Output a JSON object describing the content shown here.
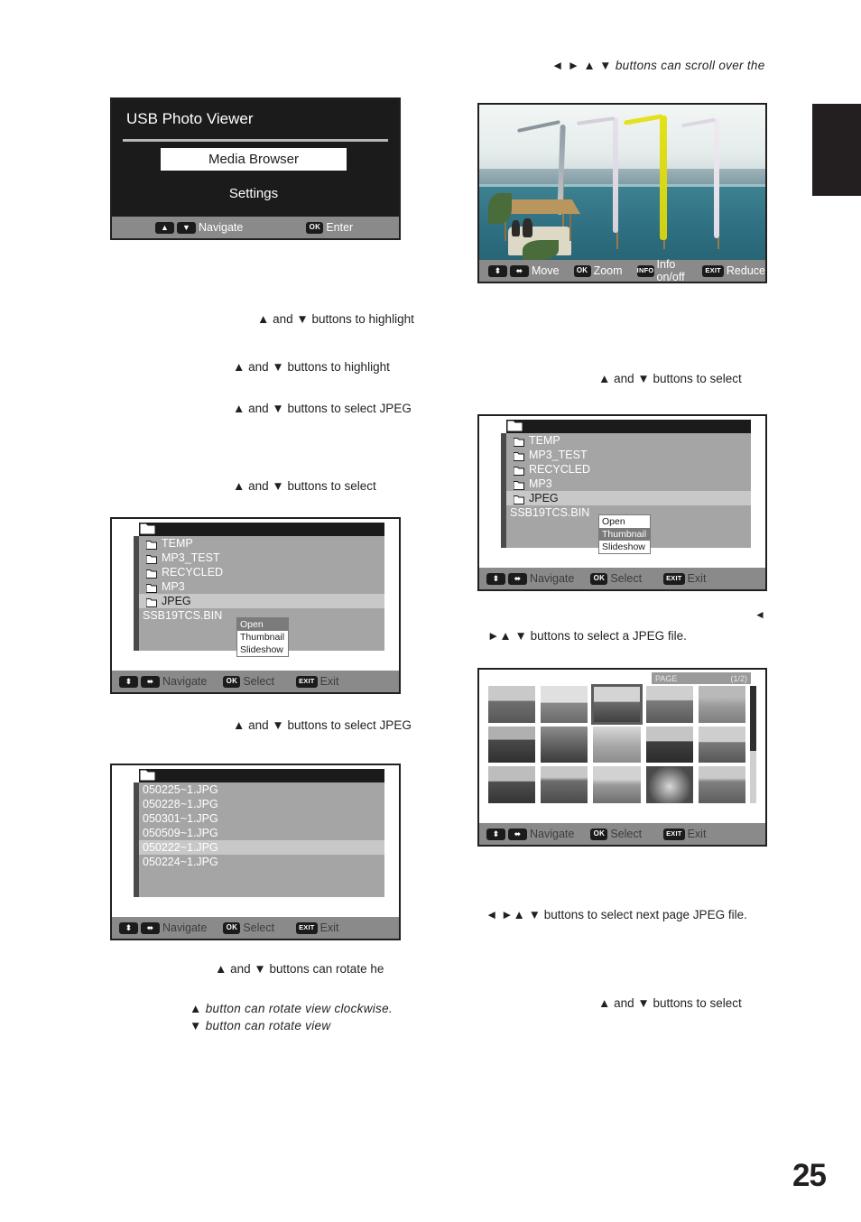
{
  "page": {
    "number": "25"
  },
  "notes": {
    "top_right": "◄ ► ▲ ▼ buttons can scroll over the",
    "left_1": "▲ and ▼ buttons to highlight",
    "left_2": "▲ and ▼ buttons to highlight",
    "left_3": "▲ and ▼ buttons to select JPEG",
    "left_4": "▲ and ▼ buttons to select",
    "left_5": "▲ and ▼ buttons to select JPEG",
    "left_6": "▲ and ▼ buttons can rotate  he",
    "left_7": "▲ button can rotate view clockwise.",
    "left_8": "▼ button can rotate view",
    "right_1": "▲ and ▼ buttons to select",
    "right_2": "◄",
    "right_3": "►▲ ▼ buttons to select a JPEG file.",
    "right_4": "◄ ►▲ ▼ buttons to select next page JPEG file.",
    "right_5": "▲ and ▼ buttons to select"
  },
  "menu_panel": {
    "title": "USB Photo Viewer",
    "items": [
      {
        "label": "Media Browser",
        "selected": true
      },
      {
        "label": "Settings",
        "selected": false
      }
    ],
    "status": [
      {
        "keys": [
          "▲",
          "▼"
        ],
        "label": "Navigate"
      },
      {
        "keys": [
          "OK"
        ],
        "label": "Enter"
      }
    ]
  },
  "photo_panel": {
    "status": [
      {
        "keys": [
          "updown",
          "leftright"
        ],
        "label": "Move"
      },
      {
        "keys": [
          "OK"
        ],
        "label": "Zoom"
      },
      {
        "keys": [
          "INFO"
        ],
        "label": "Info on/off"
      },
      {
        "keys": [
          "EXIT"
        ],
        "label": "Reduce"
      }
    ]
  },
  "browser_left": {
    "rows": [
      {
        "name": "TEMP",
        "folder": true,
        "selected": false
      },
      {
        "name": "MP3_TEST",
        "folder": true,
        "selected": false
      },
      {
        "name": "RECYCLED",
        "folder": true,
        "selected": false
      },
      {
        "name": "MP3",
        "folder": true,
        "selected": false
      },
      {
        "name": "JPEG",
        "folder": true,
        "selected": true
      },
      {
        "name": "SSB19TCS.BIN",
        "folder": false,
        "selected": false
      }
    ],
    "context_menu": [
      {
        "label": "Open",
        "selected": true
      },
      {
        "label": "Thumbnail",
        "selected": false
      },
      {
        "label": "Slideshow",
        "selected": false
      }
    ],
    "status": [
      {
        "keys": [
          "updown",
          "leftright"
        ],
        "label": "Navigate"
      },
      {
        "keys": [
          "OK"
        ],
        "label": "Select"
      },
      {
        "keys": [
          "EXIT"
        ],
        "label": "Exit"
      }
    ]
  },
  "browser_right": {
    "rows": [
      {
        "name": "TEMP",
        "folder": true,
        "selected": false
      },
      {
        "name": "MP3_TEST",
        "folder": true,
        "selected": false
      },
      {
        "name": "RECYCLED",
        "folder": true,
        "selected": false
      },
      {
        "name": "MP3",
        "folder": true,
        "selected": false
      },
      {
        "name": "JPEG",
        "folder": true,
        "selected": true
      },
      {
        "name": "SSB19TCS.BIN",
        "folder": false,
        "selected": false
      }
    ],
    "context_menu": [
      {
        "label": "Open",
        "selected": false
      },
      {
        "label": "Thumbnail",
        "selected": true
      },
      {
        "label": "Slideshow",
        "selected": false
      }
    ],
    "status": [
      {
        "keys": [
          "updown",
          "leftright"
        ],
        "label": "Navigate"
      },
      {
        "keys": [
          "OK"
        ],
        "label": "Select"
      },
      {
        "keys": [
          "EXIT"
        ],
        "label": "Exit"
      }
    ]
  },
  "file_list": {
    "rows": [
      {
        "name": "050225~1.JPG",
        "selected": false
      },
      {
        "name": "050228~1.JPG",
        "selected": false
      },
      {
        "name": "050301~1.JPG",
        "selected": false
      },
      {
        "name": "050509~1.JPG",
        "selected": false
      },
      {
        "name": "050222~1.JPG",
        "selected": true
      },
      {
        "name": "050224~1.JPG",
        "selected": false
      }
    ],
    "status": [
      {
        "keys": [
          "updown",
          "leftright"
        ],
        "label": "Navigate"
      },
      {
        "keys": [
          "OK"
        ],
        "label": "Select"
      },
      {
        "keys": [
          "EXIT"
        ],
        "label": "Exit"
      }
    ]
  },
  "thumbnail_grid": {
    "page_label": "PAGE",
    "page_count": "(1/2)",
    "selected_index": 2,
    "thumbs": [
      {
        "tone": 0.52,
        "scene": "boats"
      },
      {
        "tone": 0.62,
        "scene": "harbor"
      },
      {
        "tone": 0.46,
        "scene": "sea-figures"
      },
      {
        "tone": 0.5,
        "scene": "shore"
      },
      {
        "tone": 0.6,
        "scene": "person"
      },
      {
        "tone": 0.38,
        "scene": "beach-trees"
      },
      {
        "tone": 0.44,
        "scene": "statue"
      },
      {
        "tone": 0.66,
        "scene": "branches"
      },
      {
        "tone": 0.36,
        "scene": "pavilion"
      },
      {
        "tone": 0.56,
        "scene": "pier"
      },
      {
        "tone": 0.42,
        "scene": "palm"
      },
      {
        "tone": 0.48,
        "scene": "huts"
      },
      {
        "tone": 0.58,
        "scene": "dome"
      },
      {
        "tone": 0.4,
        "scene": "wheel"
      },
      {
        "tone": 0.54,
        "scene": "villa"
      }
    ],
    "status": [
      {
        "keys": [
          "updown",
          "leftright"
        ],
        "label": "Navigate"
      },
      {
        "keys": [
          "OK"
        ],
        "label": "Select"
      },
      {
        "keys": [
          "EXIT"
        ],
        "label": "Exit"
      }
    ]
  }
}
